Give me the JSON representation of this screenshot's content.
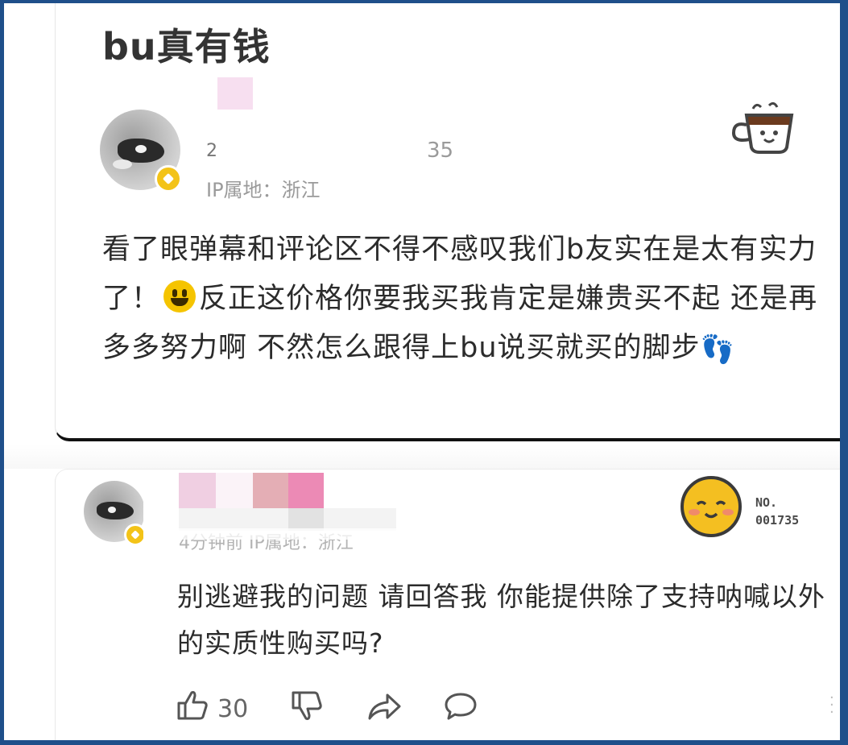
{
  "post": {
    "title": "bu真有钱"
  },
  "comment": {
    "username_partial": "2",
    "time_partial": "35",
    "ip_location": "IP属地：浙江",
    "text_before_emoji": "看了眼弹幕和评论区不得不感叹我们b友实在是太有实力了！",
    "text_after_emoji": "反正这价格你要我买我肯定是嫌贵买不起 还是再多多努力啊 不然怎么跟得上bu说买就买的脚步",
    "footprints_icon": "footprints-icon",
    "decoration_icon": "coffee-cup-sticker-icon"
  },
  "reply": {
    "meta": "4分钟前  IP属地：浙江",
    "text": "别逃避我的问题 请回答我 你能提供除了支持呐喊以外的实质性购买吗?",
    "badge_no_label": "NO.",
    "badge_no_value": "001735",
    "like_count": "30"
  },
  "colors": {
    "frame_border": "#1f4f8a",
    "badge_yellow": "#f3c318",
    "text_main": "#2b2b2b",
    "text_meta": "#9a9a9a"
  }
}
